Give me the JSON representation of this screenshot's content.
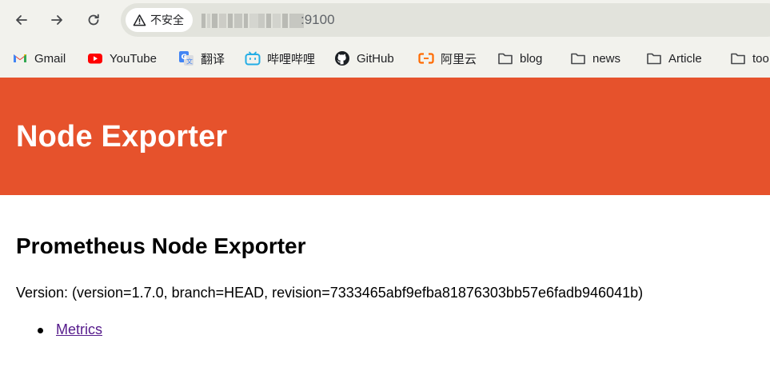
{
  "browser": {
    "security_label": "不安全",
    "url_visible_suffix": ":9100",
    "bookmarks": [
      {
        "label": "Gmail",
        "icon": "gmail-icon"
      },
      {
        "label": "YouTube",
        "icon": "youtube-icon"
      },
      {
        "label": "翻译",
        "icon": "translate-icon"
      },
      {
        "label": "哔哩哔哩",
        "icon": "bilibili-icon"
      },
      {
        "label": "GitHub",
        "icon": "github-icon"
      },
      {
        "label": "阿里云",
        "icon": "aliyun-icon"
      },
      {
        "label": "blog",
        "icon": "folder-icon"
      },
      {
        "label": "news",
        "icon": "folder-icon"
      },
      {
        "label": "Article",
        "icon": "folder-icon"
      },
      {
        "label": "too",
        "icon": "folder-icon"
      }
    ]
  },
  "page": {
    "banner_title": "Node Exporter",
    "heading": "Prometheus Node Exporter",
    "version_text": "Version: (version=1.7.0, branch=HEAD, revision=7333465abf9efba81876303bb57e6fadb946041b)",
    "links": [
      {
        "label": "Metrics"
      }
    ]
  },
  "colors": {
    "banner": "#e6522c",
    "visited_link": "#551a8b",
    "chrome_background": "#f2f2ed"
  }
}
